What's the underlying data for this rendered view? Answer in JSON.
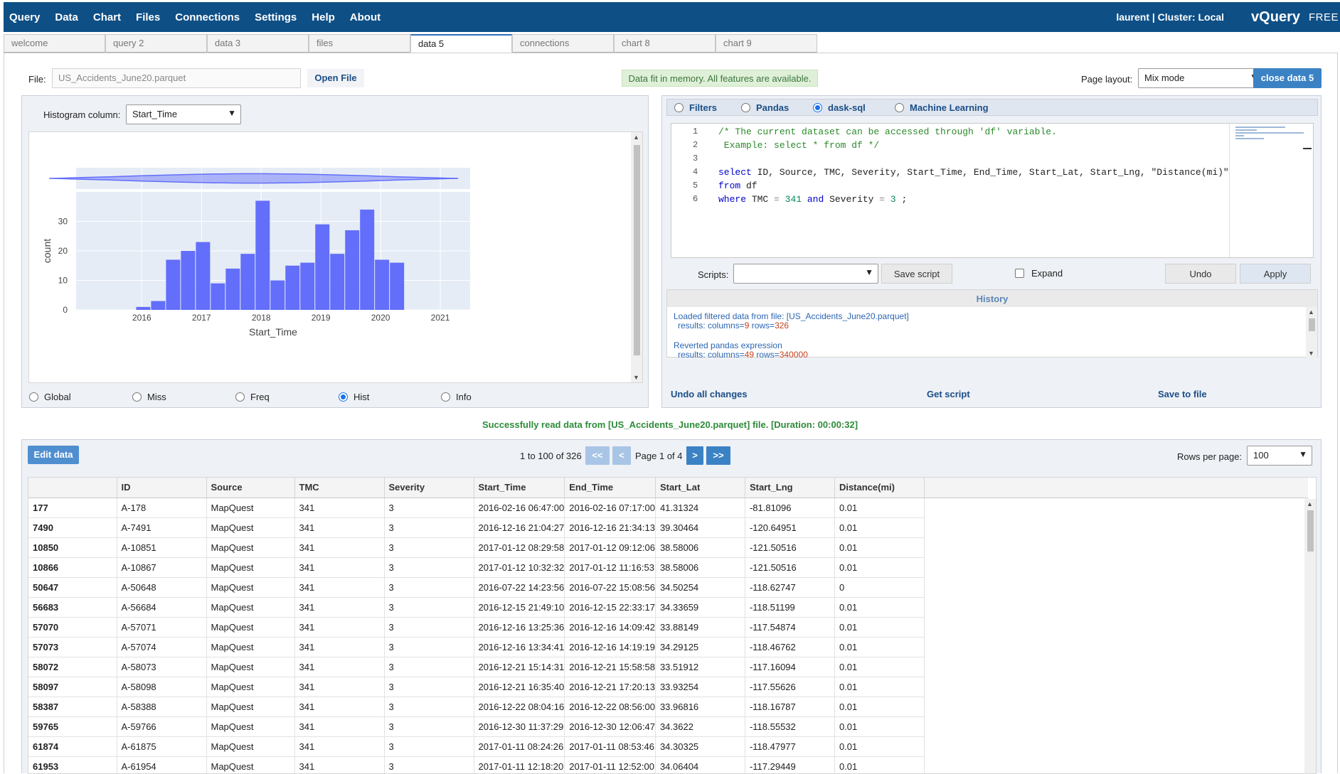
{
  "menu": [
    "Query",
    "Data",
    "Chart",
    "Files",
    "Connections",
    "Settings",
    "Help",
    "About"
  ],
  "user_cluster": "laurent | Cluster: Local",
  "brand": "vQuery",
  "edition": "FREE",
  "colors": {
    "topbar": "#0e4f86",
    "accent": "#3b82c4",
    "bar": "#636efa",
    "success": "#2e8b3a"
  },
  "tabs": [
    "welcome",
    "query 2",
    "data 3",
    "files",
    "data 5",
    "connections",
    "chart 8",
    "chart 9"
  ],
  "active_tab": "data 5",
  "file": {
    "label": "File:",
    "path": "US_Accidents_June20.parquet",
    "open_label": "Open File",
    "memory_status": "Data fit in memory. All features are available.",
    "layout_label": "Page layout:",
    "layout_value": "Mix mode",
    "close_label": "close data 5"
  },
  "histogram": {
    "column_label": "Histogram column:",
    "column_value": "Start_Time",
    "radios": [
      "Global",
      "Miss",
      "Freq",
      "Hist",
      "Info"
    ],
    "selected": "Hist"
  },
  "chart_data": {
    "type": "bar",
    "x": [
      2015.9,
      2016.15,
      2016.4,
      2016.65,
      2016.9,
      2017.15,
      2017.4,
      2017.65,
      2017.9,
      2018.15,
      2018.4,
      2018.65,
      2018.9,
      2019.15,
      2019.4,
      2019.65,
      2019.9,
      2020.15
    ],
    "bin_width": 0.25,
    "values": [
      1,
      3,
      17,
      20,
      23,
      9,
      14,
      19,
      37,
      10,
      15,
      16,
      29,
      19,
      27,
      34,
      17,
      16
    ],
    "xlabel": "Start_Time",
    "ylabel": "count",
    "x_ticks": [
      "2016",
      "2017",
      "2018",
      "2019",
      "2020",
      "2021"
    ],
    "y_ticks": [
      "0",
      "10",
      "20",
      "30"
    ],
    "xlim": [
      2014.9,
      2021.5
    ],
    "ylim": [
      0,
      40
    ],
    "violin_range": [
      2014.45,
      2021.3
    ],
    "grid": true
  },
  "query": {
    "modes": [
      "Filters",
      "Pandas",
      "dask-sql",
      "Machine Learning"
    ],
    "selected_mode": "dask-sql",
    "line_numbers": [
      "1",
      "2",
      "3",
      "4",
      "5",
      "6"
    ],
    "code": {
      "l1": "/* The current dataset can be accessed through 'df' variable.",
      "l2": " Example: select * from df */",
      "l4_kw": "select",
      "l4_rest": " ID, Source, TMC, Severity, Start_Time, End_Time, Start_Lat, Start_Lng, \"Distance(mi)\"",
      "l5_kw": "from",
      "l5_rest": " df",
      "l6_kw1": "where",
      "l6_a": " TMC ",
      "l6_op1": "=",
      "l6_num1": " 341 ",
      "l6_kw2": "and",
      "l6_b": " Severity ",
      "l6_op2": "=",
      "l6_num2": " 3",
      "l6_end": " ;"
    },
    "scripts_label": "Scripts:",
    "save_script": "Save script",
    "expand_label": "Expand",
    "undo": "Undo",
    "apply": "Apply",
    "history_title": "History",
    "history": [
      {
        "text": "Loaded filtered data from file: [US_Accidents_June20.parquet]",
        "prefix": "results: columns=",
        "cols": "9",
        "mid": " rows=",
        "rows": "326"
      },
      {
        "text": "Reverted pandas expression",
        "prefix": "results: columns=",
        "cols": "49",
        "mid": " rows=",
        "rows": "340000"
      }
    ],
    "undo_all": "Undo all changes",
    "get_script": "Get script",
    "save_to_file": "Save to file"
  },
  "success_message": "Successfully read data from [US_Accidents_June20.parquet] file. [Duration: 00:00:32]",
  "grid": {
    "edit_label": "Edit data",
    "range_text": "1 to 100 of 326",
    "first": "<<",
    "prev": "<",
    "page_text": "Page 1 of 4",
    "next": ">",
    "last": ">>",
    "rows_label": "Rows per page:",
    "rows_value": "100",
    "columns": [
      "",
      "ID",
      "Source",
      "TMC",
      "Severity",
      "Start_Time",
      "End_Time",
      "Start_Lat",
      "Start_Lng",
      "Distance(mi)"
    ],
    "rows": [
      [
        "177",
        "A-178",
        "MapQuest",
        "341",
        "3",
        "2016-02-16 06:47:00",
        "2016-02-16 07:17:00",
        "41.31324",
        "-81.81096",
        "0.01"
      ],
      [
        "7490",
        "A-7491",
        "MapQuest",
        "341",
        "3",
        "2016-12-16 21:04:27",
        "2016-12-16 21:34:13",
        "39.30464",
        "-120.64951",
        "0.01"
      ],
      [
        "10850",
        "A-10851",
        "MapQuest",
        "341",
        "3",
        "2017-01-12 08:29:58",
        "2017-01-12 09:12:06",
        "38.58006",
        "-121.50516",
        "0.01"
      ],
      [
        "10866",
        "A-10867",
        "MapQuest",
        "341",
        "3",
        "2017-01-12 10:32:32",
        "2017-01-12 11:16:53",
        "38.58006",
        "-121.50516",
        "0.01"
      ],
      [
        "50647",
        "A-50648",
        "MapQuest",
        "341",
        "3",
        "2016-07-22 14:23:56",
        "2016-07-22 15:08:56",
        "34.50254",
        "-118.62747",
        "0"
      ],
      [
        "56683",
        "A-56684",
        "MapQuest",
        "341",
        "3",
        "2016-12-15 21:49:10",
        "2016-12-15 22:33:17",
        "34.33659",
        "-118.51199",
        "0.01"
      ],
      [
        "57070",
        "A-57071",
        "MapQuest",
        "341",
        "3",
        "2016-12-16 13:25:36",
        "2016-12-16 14:09:42",
        "33.88149",
        "-117.54874",
        "0.01"
      ],
      [
        "57073",
        "A-57074",
        "MapQuest",
        "341",
        "3",
        "2016-12-16 13:34:41",
        "2016-12-16 14:19:19",
        "34.29125",
        "-118.46762",
        "0.01"
      ],
      [
        "58072",
        "A-58073",
        "MapQuest",
        "341",
        "3",
        "2016-12-21 15:14:31",
        "2016-12-21 15:58:58",
        "33.51912",
        "-117.16094",
        "0.01"
      ],
      [
        "58097",
        "A-58098",
        "MapQuest",
        "341",
        "3",
        "2016-12-21 16:35:40",
        "2016-12-21 17:20:13",
        "33.93254",
        "-117.55626",
        "0.01"
      ],
      [
        "58387",
        "A-58388",
        "MapQuest",
        "341",
        "3",
        "2016-12-22 08:04:16",
        "2016-12-22 08:56:00",
        "33.96816",
        "-118.16787",
        "0.01"
      ],
      [
        "59765",
        "A-59766",
        "MapQuest",
        "341",
        "3",
        "2016-12-30 11:37:29",
        "2016-12-30 12:06:47",
        "34.3622",
        "-118.55532",
        "0.01"
      ],
      [
        "61874",
        "A-61875",
        "MapQuest",
        "341",
        "3",
        "2017-01-11 08:24:26",
        "2017-01-11 08:53:46",
        "34.30325",
        "-118.47977",
        "0.01"
      ],
      [
        "61953",
        "A-61954",
        "MapQuest",
        "341",
        "3",
        "2017-01-11 12:18:20",
        "2017-01-11 12:52:00",
        "34.06404",
        "-117.29449",
        "0.01"
      ]
    ]
  }
}
